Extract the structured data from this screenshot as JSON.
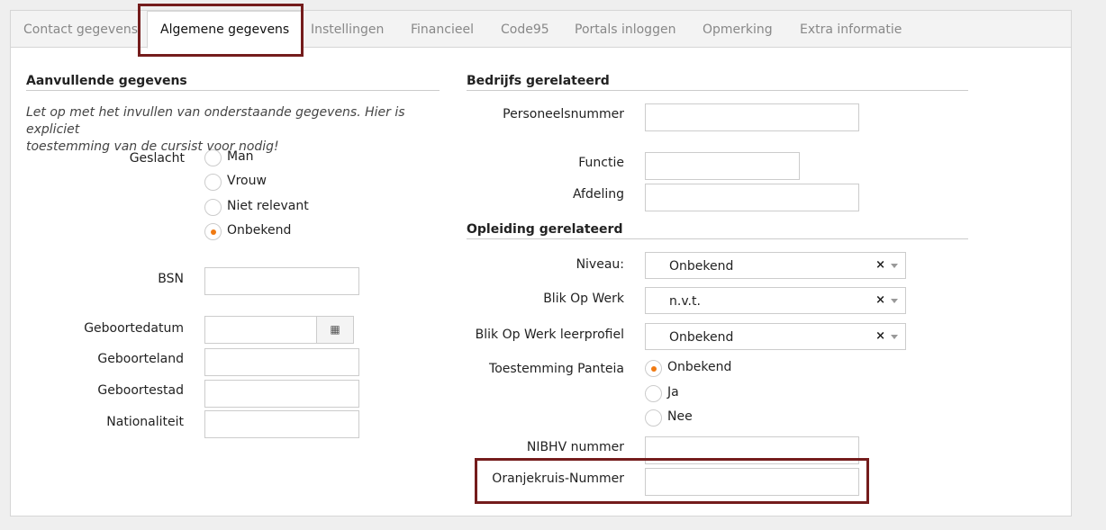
{
  "tabs": [
    {
      "label": "Contact gegevens"
    },
    {
      "label": "Algemene gegevens"
    },
    {
      "label": "Instellingen"
    },
    {
      "label": "Financieel"
    },
    {
      "label": "Code95"
    },
    {
      "label": "Portals inloggen"
    },
    {
      "label": "Opmerking"
    },
    {
      "label": "Extra informatie"
    }
  ],
  "active_tab": "Algemene gegevens",
  "left": {
    "title": "Aanvullende gegevens",
    "note_line1": "Let op met het invullen van onderstaande gegevens. Hier is expliciet",
    "note_line2": "toestemming van de cursist voor nodig!",
    "gender": {
      "label": "Geslacht",
      "options": [
        "Man",
        "Vrouw",
        "Niet relevant",
        "Onbekend"
      ],
      "selected": "Onbekend"
    },
    "bsn": {
      "label": "BSN",
      "value": ""
    },
    "birthdate": {
      "label": "Geboortedatum",
      "value": "",
      "icon": "calendar-icon"
    },
    "birth_country": {
      "label": "Geboorteland",
      "value": ""
    },
    "birth_city": {
      "label": "Geboortestad",
      "value": ""
    },
    "nationality": {
      "label": "Nationaliteit",
      "value": ""
    }
  },
  "right": {
    "company_title": "Bedrijfs gerelateerd",
    "employee_number": {
      "label": "Personeelsnummer",
      "value": ""
    },
    "function": {
      "label": "Functie",
      "value": ""
    },
    "department": {
      "label": "Afdeling",
      "value": ""
    },
    "education_title": "Opleiding gerelateerd",
    "level": {
      "label": "Niveau:",
      "value": "Onbekend"
    },
    "blik": {
      "label": "Blik Op Werk",
      "value": "n.v.t."
    },
    "blik_profile": {
      "label": "Blik Op Werk leerprofiel",
      "value": "Onbekend"
    },
    "panteia": {
      "label": "Toestemming Panteia",
      "options": [
        "Onbekend",
        "Ja",
        "Nee"
      ],
      "selected": "Onbekend"
    },
    "nibhv": {
      "label": "NIBHV nummer",
      "value": ""
    },
    "oranjekruis": {
      "label": "Oranjekruis-Nummer",
      "value": ""
    }
  },
  "glyphs": {
    "clear": "×",
    "calendar": "▦"
  },
  "colors": {
    "highlight": "#741c1c",
    "radio_selected": "#f07a12"
  }
}
